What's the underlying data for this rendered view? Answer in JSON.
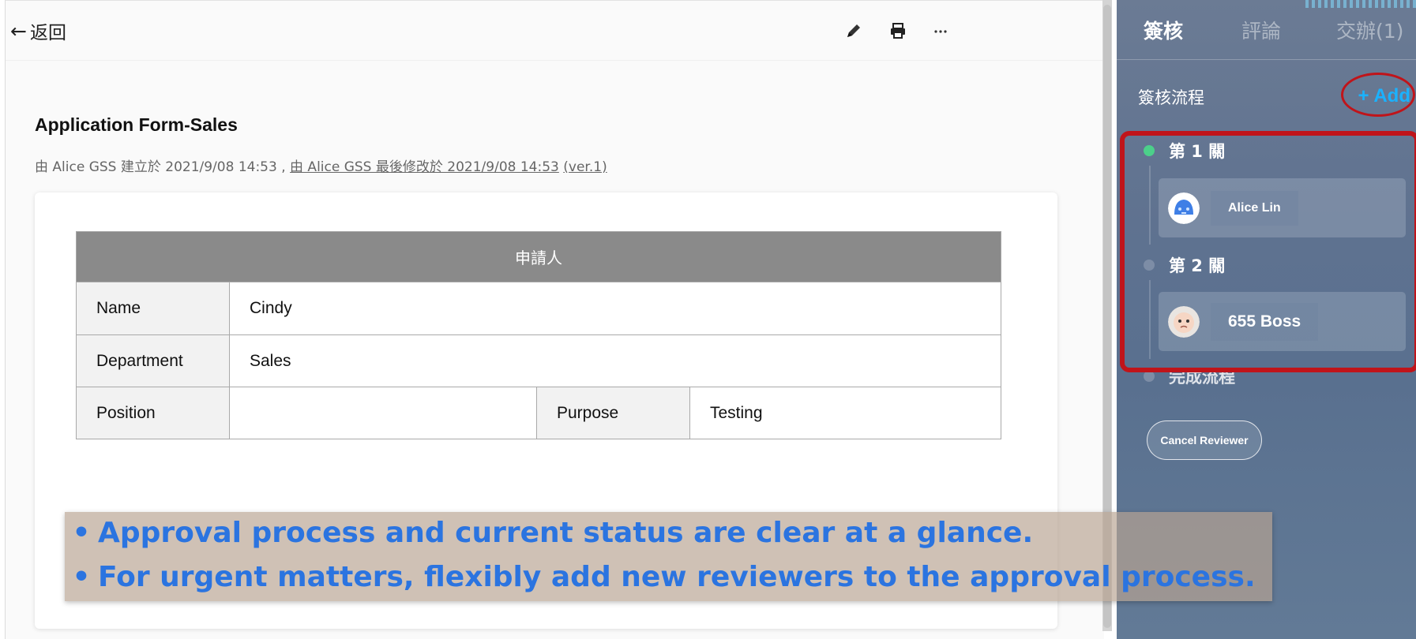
{
  "header": {
    "back_label": "返回",
    "tools": [
      "pencil-icon",
      "printer-icon",
      "more-icon"
    ]
  },
  "document": {
    "title": "Application Form-Sales",
    "meta_prefix": "由 Alice GSS 建立於 2021/9/08 14:53 , ",
    "meta_modified": "由 Alice GSS 最後修改於 2021/9/08 14:53",
    "meta_version": "(ver.1)",
    "form": {
      "header": "申請人",
      "name_label": "Name",
      "name_value": "Cindy",
      "department_label": "Department",
      "department_value": "Sales",
      "position_label": "Position",
      "position_value": "",
      "purpose_label": "Purpose",
      "purpose_value": "Testing"
    }
  },
  "banner": {
    "bullet": "•",
    "line1": "Approval process and current status are clear at a glance.",
    "line2": "For urgent matters, flexibly add new reviewers to the approval process."
  },
  "panel": {
    "tabs": [
      "簽核",
      "評論",
      "交辦(1)"
    ],
    "active_tab": "簽核",
    "flow_title": "簽核流程",
    "add_label": "+ Add",
    "stages": [
      {
        "label": "第 1 關",
        "status_color": "#4cd08a",
        "reviewer": "Alice Lin",
        "avatar": "robot-avatar"
      },
      {
        "label": "第 2 關",
        "status_color": "#7d8da6",
        "reviewer": "655 Boss",
        "avatar": "baby-avatar"
      }
    ],
    "complete_label": "完成流程",
    "cancel_label": "Cancel Reviewer"
  },
  "colors": {
    "accent_blue": "#2b74e0",
    "add_blue": "#1ab2ff",
    "highlight_red": "#c0141a",
    "table_header_gray": "#8a8a8a"
  }
}
